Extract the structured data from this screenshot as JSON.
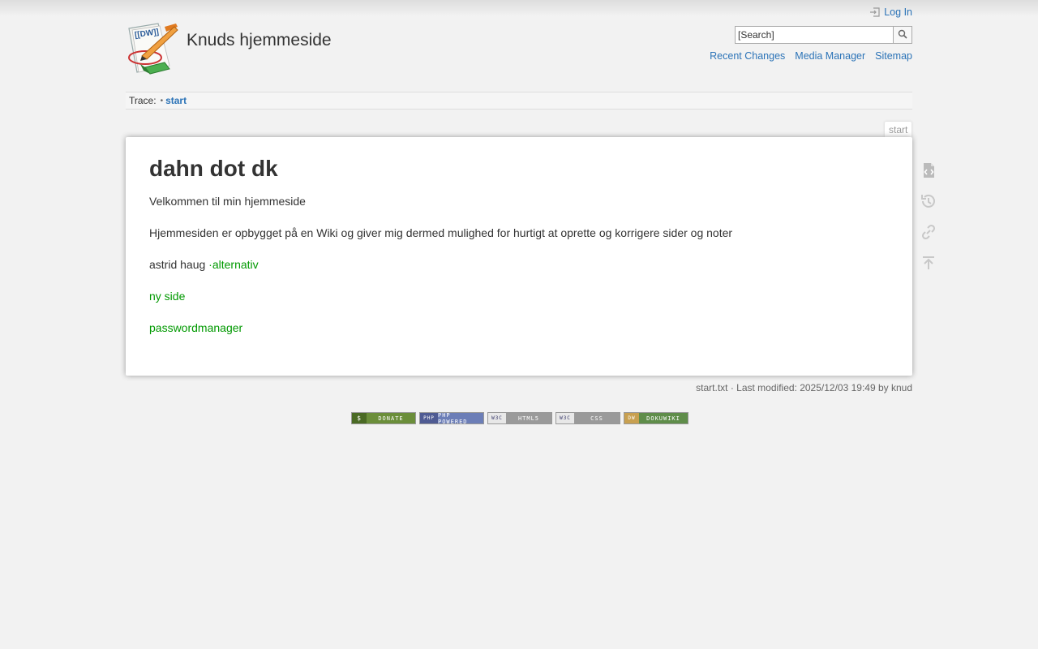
{
  "header": {
    "site_title": "Knuds hjemmeside",
    "login_label": "Log In",
    "search_placeholder": "[Search]",
    "search_value": "",
    "site_tools": [
      "Recent Changes",
      "Media Manager",
      "Sitemap"
    ]
  },
  "breadcrumbs": {
    "label": "Trace:",
    "separator": "•",
    "items": [
      "start"
    ]
  },
  "page": {
    "id": "start",
    "title": "dahn dot dk",
    "intro": "Velkommen til min hjemmeside",
    "description": "Hjemmesiden er opbygget på en Wiki og giver mig dermed mulighed for hurtigt at oprette og korrigere sider og noter",
    "line3_text": "astrid haug ",
    "line3_link": "·alternativ",
    "link_new_page": "ny side",
    "link_password": "passwordmanager"
  },
  "page_tools": [
    "show-source-icon",
    "old-revisions-icon",
    "backlinks-icon",
    "back-to-top-icon"
  ],
  "docinfo": {
    "filename": "start.txt",
    "modified": " · Last modified: 2025/12/03 19:49 by ",
    "user": "knud"
  },
  "badges": [
    {
      "name": "donate",
      "text": "DONATE",
      "color": "#6b8e3a",
      "left": "$"
    },
    {
      "name": "php-powered",
      "text": "PHP POWERED",
      "color": "#6c7eb7",
      "left": "PHP"
    },
    {
      "name": "valid-html5",
      "text": "HTML5",
      "color": "#9a9a9a",
      "left": "W3C"
    },
    {
      "name": "valid-css",
      "text": "CSS",
      "color": "#9a9a9a",
      "left": "W3C"
    },
    {
      "name": "dokuwiki",
      "text": "DOKUWIKI",
      "color": "#5f8d4a",
      "left": "DW"
    }
  ],
  "colors": {
    "link": "#2b73b7",
    "wikilink": "#009900",
    "background": "#f2f2f2"
  }
}
